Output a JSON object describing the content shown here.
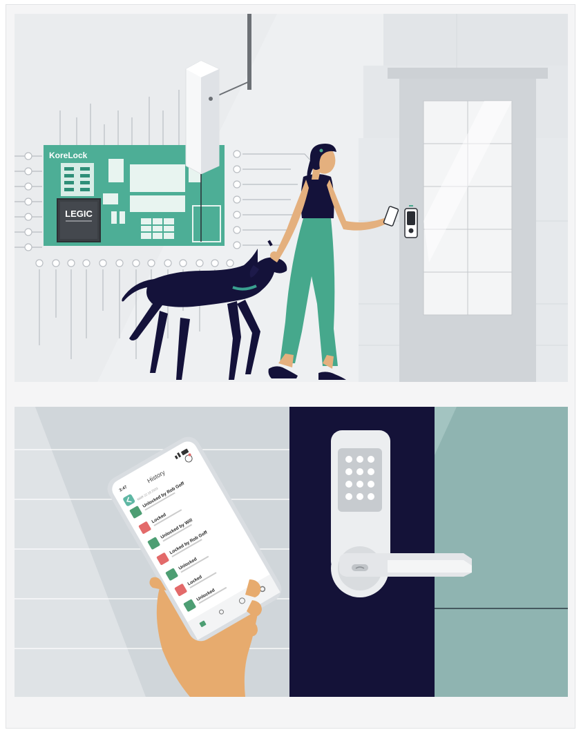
{
  "top_scene": {
    "board_brand": "KoreLock",
    "chip_label": "LEGIC",
    "colors": {
      "board": "#4dae96",
      "board_dark": "#2f8f78",
      "chip": "#3b3f44",
      "navy": "#14123a",
      "pants": "#46a88c",
      "skin": "#e4b07e",
      "wall": "#e6e9ec",
      "door": "#c9cdd1",
      "trace": "#b9bdc2"
    }
  },
  "bottom_scene": {
    "phone": {
      "time": "3:47",
      "screen_title": "History",
      "date_header": "MAR 22 18 2023",
      "entries": [
        {
          "title": "Unlocked by Rob Goff",
          "status": "unlocked"
        },
        {
          "title": "Locked",
          "status": "locked"
        },
        {
          "title": "Unlocked by Will",
          "status": "unlocked"
        },
        {
          "title": "Locked by Rob Goff",
          "status": "locked"
        },
        {
          "title": "Unlocked",
          "status": "unlocked"
        },
        {
          "title": "Locked",
          "status": "locked"
        },
        {
          "title": "Unlocked",
          "status": "unlocked"
        }
      ],
      "nav_icons": [
        "lock-icon",
        "user-icon",
        "clock-icon",
        "gear-icon"
      ]
    },
    "colors": {
      "door_navy": "#141238",
      "teal_wall": "#8fb4b1",
      "lock_body": "#eceef0",
      "unlocked_badge": "#4d9e73",
      "locked_badge": "#e36a6a",
      "hand": "#e7ab6e"
    }
  }
}
